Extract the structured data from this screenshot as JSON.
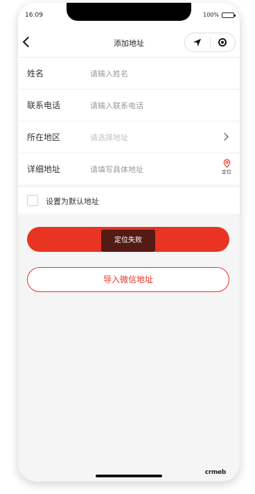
{
  "status_bar": {
    "time": "16:09",
    "battery": "100%"
  },
  "nav": {
    "title": "添加地址"
  },
  "form": {
    "rows": [
      {
        "label": "姓名",
        "placeholder": "请输入姓名"
      },
      {
        "label": "联系电话",
        "placeholder": "请输入联系电话"
      },
      {
        "label": "所在地区",
        "placeholder": "请选择地址"
      },
      {
        "label": "详细地址",
        "placeholder": "请填写具体地址",
        "locate_label": "定位"
      }
    ]
  },
  "default_address": {
    "label": "设置为默认地址"
  },
  "buttons": {
    "save_label": "",
    "import_wechat_label": "导入微信地址"
  },
  "toast": {
    "message": "定位失败"
  },
  "watermark": {
    "text": "crmeb"
  },
  "colors": {
    "accent": "#e93323"
  }
}
